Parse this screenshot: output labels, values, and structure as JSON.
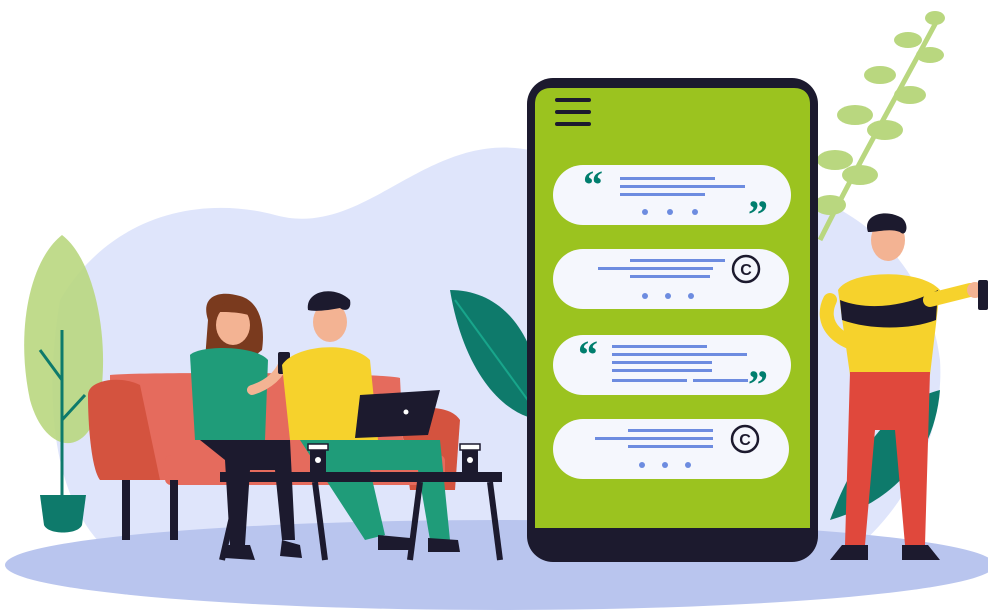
{
  "palette": {
    "background": "#ffffff",
    "blob": "#dfe5fb",
    "floor": "#b9c5ee",
    "phone_body": "#1c1a2e",
    "phone_screen": "#9bc31f",
    "bubble": "#f5f7fd",
    "quote_mark": "#007e6e",
    "text_line": "#6d8ce0",
    "dot": "#6d8ce0",
    "copyright_mark": "#1c1a2e",
    "sofa": "#e56b5d",
    "sofa_dark": "#d4533f",
    "table": "#1c1a2e",
    "leaf_dark": "#0e7a6b",
    "leaf_light": "#b9d77f",
    "woman_shirt": "#1f9c79",
    "man_shirt": "#f6d22c",
    "man_pants": "#1f9c79",
    "standing_shirt": "#f6d22c",
    "standing_stripe": "#1c1a2e",
    "standing_pants": "#e0483c",
    "skin": "#f3b393",
    "hair_dark": "#1c1a2e",
    "hair_woman": "#7a3a1e"
  },
  "phone": {
    "menu_icon": "hamburger-menu-icon",
    "messages": [
      {
        "kind": "quote",
        "open_icon": "open-quote-icon",
        "close_icon": "close-quote-icon",
        "lines": 3,
        "dots": 3
      },
      {
        "kind": "copyright",
        "icon": "copyright-icon",
        "lines": 3,
        "dots": 3
      },
      {
        "kind": "quote",
        "open_icon": "open-quote-icon",
        "close_icon": "close-quote-icon",
        "lines": 4,
        "dots": 0
      },
      {
        "kind": "copyright",
        "icon": "copyright-icon",
        "lines": 3,
        "dots": 3
      }
    ]
  },
  "people": [
    "woman-with-phone",
    "man-with-laptop",
    "standing-man-with-phone"
  ],
  "icons": {
    "copyright_glyph": "©"
  }
}
